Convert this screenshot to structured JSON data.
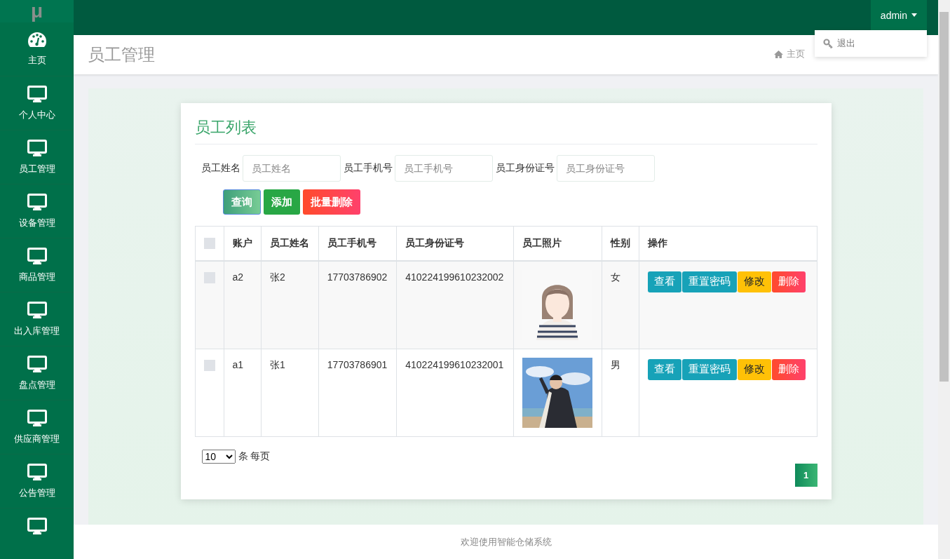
{
  "logo": "μ",
  "sidebar": {
    "items": [
      {
        "label": "主页",
        "kind": "dashboard"
      },
      {
        "label": "个人中心",
        "kind": "monitor"
      },
      {
        "label": "员工管理",
        "kind": "monitor"
      },
      {
        "label": "设备管理",
        "kind": "monitor"
      },
      {
        "label": "商品管理",
        "kind": "monitor"
      },
      {
        "label": "出入库管理",
        "kind": "monitor"
      },
      {
        "label": "盘点管理",
        "kind": "monitor"
      },
      {
        "label": "供应商管理",
        "kind": "monitor"
      },
      {
        "label": "公告管理",
        "kind": "monitor"
      },
      {
        "kind": "monitor"
      }
    ]
  },
  "user_menu": {
    "label": "admin",
    "expanded": true,
    "items": [
      {
        "label": "退出"
      }
    ]
  },
  "page_title": "员工管理",
  "breadcrumb": [
    {
      "label": "主页"
    }
  ],
  "card": {
    "title": "员工列表",
    "filters": [
      {
        "label": "员工姓名",
        "placeholder": "员工姓名"
      },
      {
        "label": "员工手机号",
        "placeholder": "员工手机号"
      },
      {
        "label": "员工身份证号",
        "placeholder": "员工身份证号"
      }
    ],
    "buttons": [
      {
        "label": "查询",
        "kind": "query"
      },
      {
        "label": "添加",
        "kind": "add"
      },
      {
        "label": "批量删除",
        "kind": "delete"
      }
    ],
    "table": {
      "select_all": {
        "checked": false
      },
      "columns": [
        "账户",
        "员工姓名",
        "员工手机号",
        "员工身份证号",
        "员工照片",
        "性别",
        "操作"
      ],
      "rows": [
        {
          "checked": false,
          "account": "a2",
          "name": "张2",
          "phone": "17703786902",
          "id_number": "410224199610232002",
          "gender": "女",
          "actions": [
            {
              "label": "查看",
              "kind": "view"
            },
            {
              "label": "重置密码",
              "kind": "reset"
            },
            {
              "label": "修改",
              "kind": "edit"
            },
            {
              "label": "删除",
              "kind": "delete"
            }
          ]
        },
        {
          "checked": false,
          "account": "a1",
          "name": "张1",
          "phone": "17703786901",
          "id_number": "410224199610232001",
          "gender": "男",
          "actions": [
            {
              "label": "查看",
              "kind": "view"
            },
            {
              "label": "重置密码",
              "kind": "reset"
            },
            {
              "label": "修改",
              "kind": "edit"
            },
            {
              "label": "删除",
              "kind": "delete"
            }
          ]
        }
      ]
    },
    "page_size": "10",
    "page_size_label": "条 每页",
    "pages": [
      {
        "label": "1",
        "selected": true
      }
    ]
  },
  "footer": "欢迎使用智能仓储系统"
}
